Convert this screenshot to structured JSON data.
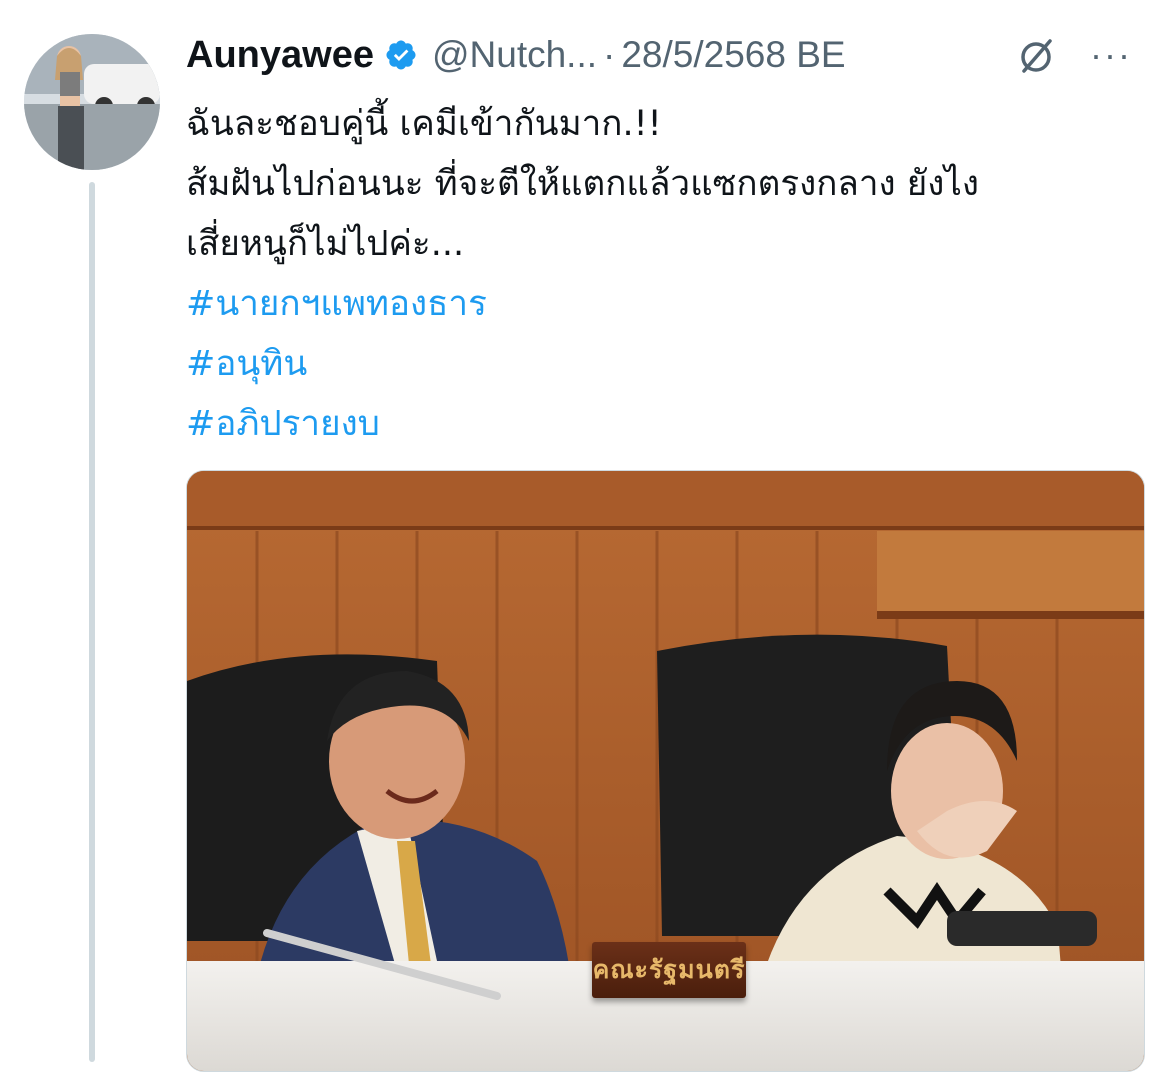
{
  "tweet": {
    "display_name": "Aunyawee",
    "handle": "@Nutch...",
    "separator": "·",
    "date": "28/5/2568 BE",
    "verified": true,
    "more_label": "···",
    "text_lines": [
      "ฉันละชอบคู่นี้ เคมีเข้ากันมาก.!!",
      "ส้มฝันไปก่อนนะ ที่จะตีให้แตกแล้วแซกตรงกลาง ยังไง",
      "เสี่ยหนูก็ไม่ไปค่ะ..."
    ],
    "hashtags": [
      "#นายกฯแพทองธาร",
      "#อนุทิน",
      "#อภิปรายงบ"
    ]
  },
  "media": {
    "nameplate_text": "คณะรัฐมนตรี"
  },
  "colors": {
    "link": "#1d9bf0",
    "secondary_text": "#536471",
    "verified": "#1d9bf0",
    "thread_line": "#cfd9de"
  },
  "icons": {
    "verified": "verified-badge-icon",
    "grok": "grok-icon",
    "more": "more-options-icon"
  }
}
